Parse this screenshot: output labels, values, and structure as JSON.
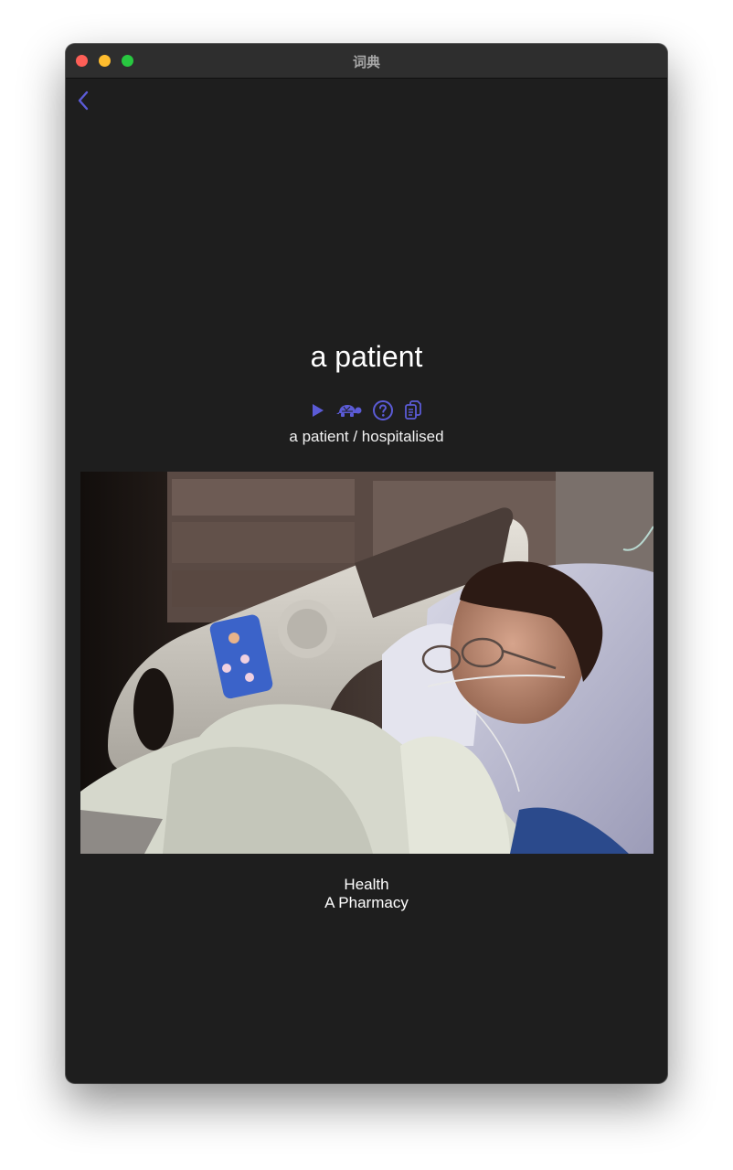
{
  "window": {
    "title": "词典"
  },
  "toolbar": {
    "back_icon": "chevron-left-icon"
  },
  "entry": {
    "word": "a patient",
    "translation": "a patient / hospitalised",
    "image_alt": "Patient sleeping in a hospital bed with a nasal cannula",
    "category": "Health",
    "subcategory": "A Pharmacy"
  },
  "actions": [
    {
      "name": "play-icon"
    },
    {
      "name": "turtle-icon"
    },
    {
      "name": "help-icon"
    },
    {
      "name": "copy-icon"
    }
  ],
  "colors": {
    "accent": "#5b5bd6",
    "background": "#1e1e1e",
    "titlebar": "#2e2e2e"
  }
}
